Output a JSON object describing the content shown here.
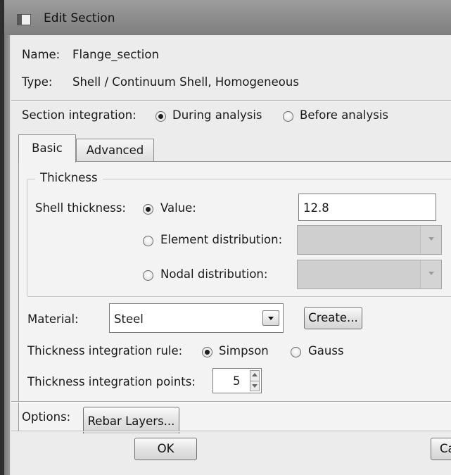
{
  "window": {
    "title": "Edit Section"
  },
  "section": {
    "name_label": "Name:",
    "name_value": "Flange_section",
    "type_label": "Type:",
    "type_value": "Shell / Continuum Shell, Homogeneous"
  },
  "integration": {
    "label": "Section integration:",
    "options": [
      "During analysis",
      "Before analysis"
    ],
    "selected": "During analysis"
  },
  "tabs": [
    {
      "label": "Basic",
      "active": true
    },
    {
      "label": "Advanced",
      "active": false
    }
  ],
  "thickness": {
    "group_label": "Thickness",
    "shell_label": "Shell thickness:",
    "value_option": "Value:",
    "value": "12.8",
    "element_option": "Element distribution:",
    "nodal_option": "Nodal distribution:",
    "selected": "Value:"
  },
  "material": {
    "label": "Material:",
    "value": "Steel",
    "create_label": "Create..."
  },
  "rule": {
    "label": "Thickness integration rule:",
    "options": [
      "Simpson",
      "Gauss"
    ],
    "selected": "Simpson"
  },
  "points": {
    "label": "Thickness integration points:",
    "value": "5"
  },
  "options": {
    "label": "Options:",
    "rebar_label": "Rebar Layers..."
  },
  "footer": {
    "ok_label": "OK",
    "cancel_label": "Ca"
  }
}
